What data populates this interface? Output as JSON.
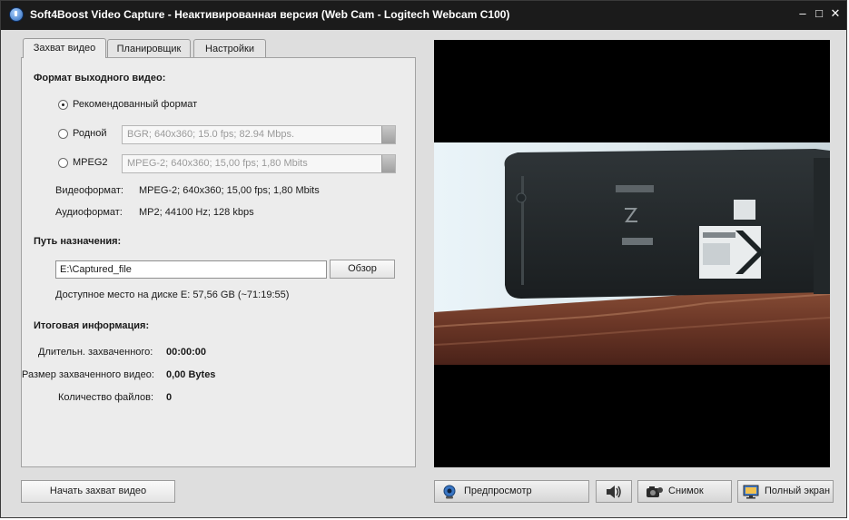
{
  "window": {
    "title": "Soft4Boost Video Capture - Неактивированная версия (Web Cam - Logitech Webcam C100)",
    "controls": {
      "minimize": "–",
      "maximize": "□",
      "close": "✕"
    }
  },
  "tabs": [
    {
      "label": "Захват видео"
    },
    {
      "label": "Планировщик"
    },
    {
      "label": "Настройки"
    }
  ],
  "output_format": {
    "heading": "Формат выходного видео:",
    "recommended_label": "Рекомендованный формат",
    "native_label": "Родной",
    "native_value": "BGR; 640x360; 15.0 fps; 82.94 Mbps.",
    "mpeg2_label": "MPEG2",
    "mpeg2_value": "MPEG-2; 640x360; 15,00 fps; 1,80 Mbits",
    "selected": "recommended",
    "video_format_label": "Видеоформат:",
    "video_format_value": "MPEG-2; 640x360; 15,00 fps; 1,80 Mbits",
    "audio_format_label": "Аудиоформат:",
    "audio_format_value": "MP2; 44100 Hz; 128 kbps"
  },
  "destination": {
    "heading": "Путь назначения:",
    "path_value": "E:\\Captured_file",
    "browse_label": "Обзор",
    "free_space": "Доступное место на диске E: 57,56 GB (~71:19:55)"
  },
  "summary": {
    "heading": "Итоговая информация:",
    "duration_label": "Длительн. захваченного:",
    "duration_value": "00:00:00",
    "size_label": "Размер захваченного видео:",
    "size_value": "0,00 Bytes",
    "files_label": "Количество файлов:",
    "files_value": "0"
  },
  "buttons": {
    "start_capture": "Начать захват видео",
    "preview": "Предпросмотр",
    "snapshot": "Снимок",
    "fullscreen": "Полный экран"
  },
  "icons": {
    "app": "app-logo-icon",
    "preview": "webcam-icon",
    "volume": "speaker-icon",
    "snapshot": "camera-icon",
    "fullscreen": "monitor-icon"
  },
  "colors": {
    "titlebar": "#1b1b1b",
    "window_bg": "#dedede",
    "video_bg": "#000000"
  }
}
